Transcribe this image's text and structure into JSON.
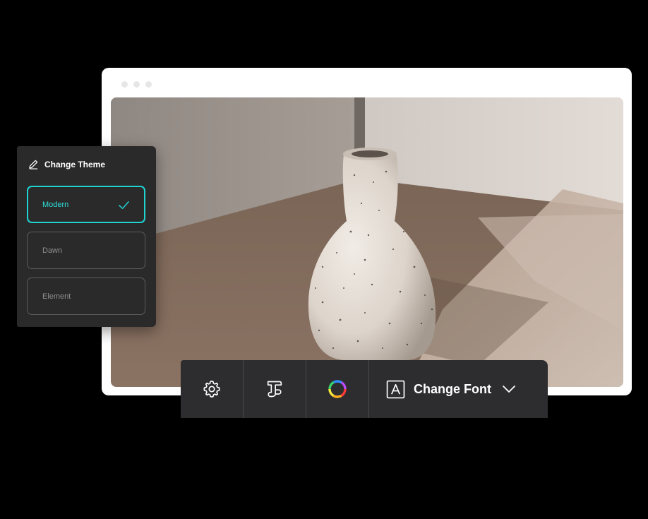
{
  "theme_panel": {
    "title": "Change Theme",
    "options": [
      {
        "label": "Modern",
        "selected": true
      },
      {
        "label": "Dawn",
        "selected": false
      },
      {
        "label": "Element",
        "selected": false
      }
    ]
  },
  "toolbar": {
    "items": [
      {
        "icon": "gear-icon"
      },
      {
        "icon": "text-style-icon"
      },
      {
        "icon": "color-wheel-icon"
      }
    ],
    "font_button_label": "Change Font"
  },
  "colors": {
    "accent": "#1fd3d1",
    "panel_bg": "#2a2a2b",
    "toolbar_bg": "#2d2d2f"
  }
}
